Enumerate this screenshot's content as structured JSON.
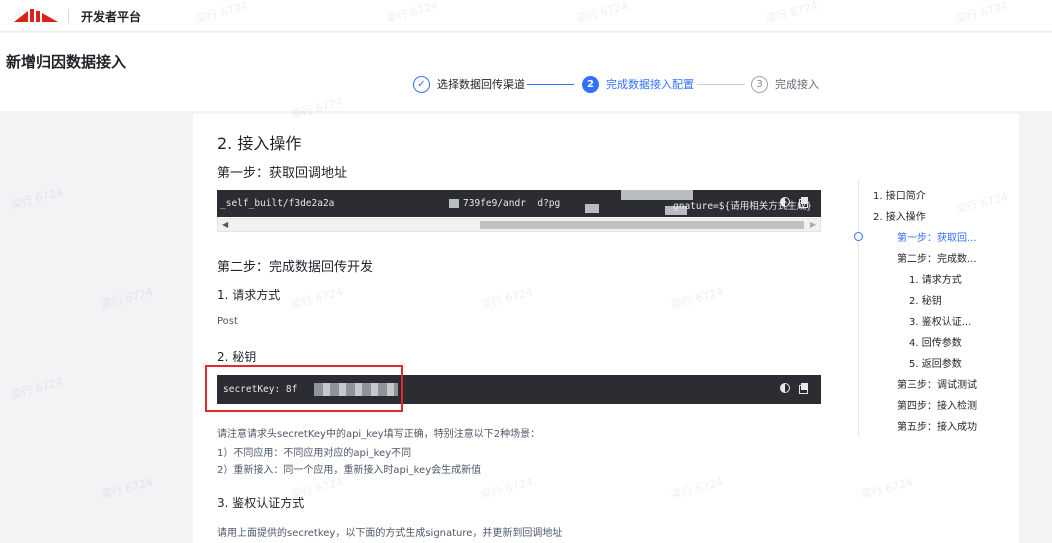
{
  "topbar": {
    "logo": "brand-logo",
    "platform_name": "开发者平台"
  },
  "header": {
    "page_title": "新增归因数据接入",
    "steps": [
      {
        "number": "✓",
        "label": "选择数据回传渠道",
        "state": "done"
      },
      {
        "number": "2",
        "label": "完成数据接入配置",
        "state": "active"
      },
      {
        "number": "3",
        "label": "完成接入",
        "state": "todo"
      }
    ]
  },
  "content": {
    "section_title": "2. 接入操作",
    "step1_title": "第一步：获取回调地址",
    "callback_code": {
      "part1": "_self_built/f3de2a2a",
      "part2": "739fe9/andr  d?pg",
      "part3": "gnature=${请用相关方式生成}"
    },
    "step2_title": "第二步：完成数据回传开发",
    "request_method_title": "1. 请求方式",
    "request_method_value": "Post",
    "secret_title": "2. 秘钥",
    "secret_code": "secretKey: 8f",
    "note_line1": "请注意请求头secretKey中的api_key填写正确，特别注意以下2种场景：",
    "note_line2": "1）不同应用：不同应用对应的api_key不同",
    "note_line3": "2）重新接入：同一个应用，重新接入时api_key会生成新值",
    "auth_title": "3. 鉴权认证方式",
    "auth_desc": "请用上面提供的secretkey，以下面的方式生成signature，并更新到回调地址"
  },
  "toc": {
    "items": [
      {
        "label": "1. 接口简介"
      },
      {
        "label": "2. 接入操作"
      },
      {
        "label": "第一步：获取回..."
      },
      {
        "label": "第二步：完成数..."
      },
      {
        "label": "1. 请求方式"
      },
      {
        "label": "2. 秘钥"
      },
      {
        "label": "3. 鉴权认证..."
      },
      {
        "label": "4. 回传参数"
      },
      {
        "label": "5. 返回参数"
      },
      {
        "label": "第三步：调试测试"
      },
      {
        "label": "第四步：接入检测"
      },
      {
        "label": "第五步：接入成功"
      }
    ]
  },
  "watermark": "梁行 6724",
  "colors": {
    "accent": "#3370ff",
    "code_bg": "#2b2d33",
    "highlight": "#e02b2b",
    "logo_red": "#d9221b"
  }
}
